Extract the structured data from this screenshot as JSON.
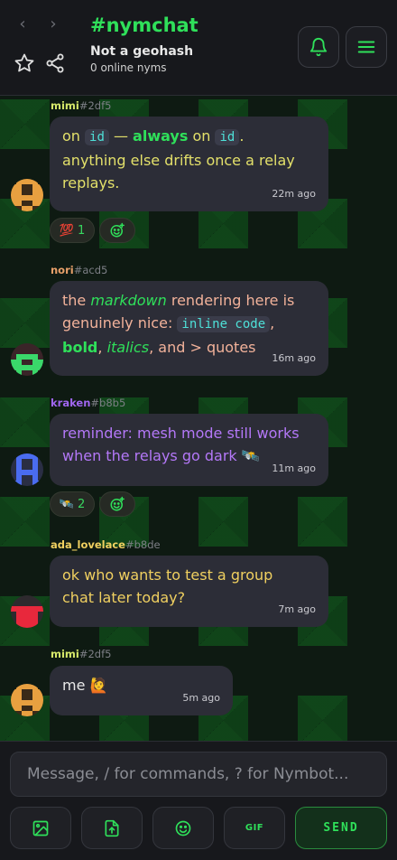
{
  "header": {
    "back_glyph": "‹",
    "forward_glyph": "›",
    "title": "#nymchat",
    "subtitle": "Not a geohash",
    "online": "0 online nyms"
  },
  "messages": [
    {
      "nick": "mimi",
      "hash": "#2df5",
      "nick_color": "#d6e86a",
      "parts": {
        "a": "on ",
        "code1": "id",
        "b": " — ",
        "bold": "always",
        "c": " on ",
        "code2": "id",
        "d": "."
      },
      "line2": "anything else drifts once a relay",
      "line3": "replays.",
      "text_color": "#e3e06a",
      "time": "22m ago",
      "reaction": {
        "emoji": "💯",
        "count": "1"
      }
    },
    {
      "nick": "nori",
      "hash": "#acd5",
      "nick_color": "#e8a06a",
      "parts": {
        "a": "the ",
        "italic": "markdown",
        "b": " rendering here is",
        "c": "genuinely nice: ",
        "code": "inline code",
        "d": ",",
        "bold": "bold",
        "e": ", ",
        "italic2": "italics",
        "f": ", and > quotes"
      },
      "text_color": "#f2b29a",
      "time": "16m ago"
    },
    {
      "nick": "kraken",
      "hash": "#b8b5",
      "nick_color": "#a066f0",
      "line1": "reminder: mesh mode still works",
      "line2": "when the relays go dark 🛰️",
      "text_color": "#b478f8",
      "time": "11m ago",
      "reaction": {
        "emoji": "🛰️",
        "count": "2"
      }
    },
    {
      "nick": "ada_lovelace",
      "hash": "#b8de",
      "nick_color": "#f0d060",
      "line1": "ok who wants to test a group",
      "line2": "chat later today?",
      "text_color": "#f0d060",
      "time": "7m ago"
    },
    {
      "nick": "mimi",
      "hash": "#2df5",
      "nick_color": "#d6e86a",
      "line1": "me 🙋",
      "text_color": "#e8e8e8",
      "time": "5m ago"
    }
  ],
  "composer": {
    "placeholder": "Message, / for commands, ? for Nymbot...",
    "gif_label": "GIF",
    "send_label": "SEND"
  },
  "colors": {
    "accent": "#2fe05a",
    "header_bg": "#17181c",
    "bubble_bg": "#2c2d37"
  },
  "icons": [
    "star-icon",
    "share-icon",
    "bell-icon",
    "menu-icon",
    "image-icon",
    "file-upload-icon",
    "emoji-icon",
    "add-reaction-icon"
  ]
}
